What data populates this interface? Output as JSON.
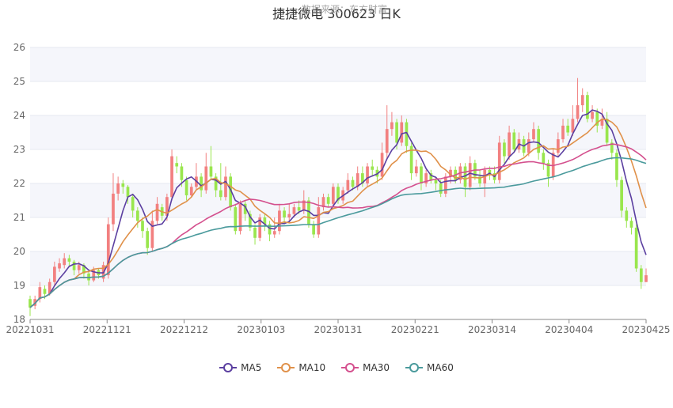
{
  "chart_data": {
    "type": "candlestick",
    "title": "捷捷微电 300623 日K",
    "watermark": "数据来源：东方财富",
    "ylim": [
      18,
      26
    ],
    "yticks": [
      18,
      19,
      20,
      21,
      22,
      23,
      24,
      25,
      26
    ],
    "xtick_labels": [
      "20221031",
      "20221121",
      "20221212",
      "20230103",
      "20230131",
      "20230221",
      "20230314",
      "20230404",
      "20230425"
    ],
    "colors": {
      "up": "#f28080",
      "down": "#99e64d",
      "grid": "#e6e8f0",
      "band": "#f5f6fb",
      "axis": "#888888"
    },
    "legend_position": "bottom-center",
    "candles": [
      [
        18.6,
        18.35,
        18.7,
        18.1
      ],
      [
        18.4,
        18.6,
        18.7,
        18.3
      ],
      [
        18.6,
        18.95,
        19.1,
        18.5
      ],
      [
        18.9,
        18.75,
        19.0,
        18.6
      ],
      [
        18.75,
        19.1,
        19.2,
        18.7
      ],
      [
        19.1,
        19.55,
        19.7,
        19.0
      ],
      [
        19.5,
        19.65,
        19.8,
        19.4
      ],
      [
        19.6,
        19.8,
        19.95,
        19.5
      ],
      [
        19.8,
        19.7,
        19.9,
        19.55
      ],
      [
        19.7,
        19.45,
        19.75,
        19.3
      ],
      [
        19.45,
        19.6,
        19.7,
        19.35
      ],
      [
        19.6,
        19.35,
        19.65,
        19.2
      ],
      [
        19.35,
        19.15,
        19.4,
        19.0
      ],
      [
        19.15,
        19.45,
        19.55,
        19.1
      ],
      [
        19.45,
        19.3,
        19.5,
        19.2
      ],
      [
        19.2,
        19.6,
        19.7,
        19.1
      ],
      [
        19.3,
        20.8,
        21.0,
        19.2
      ],
      [
        20.8,
        21.7,
        22.3,
        20.6
      ],
      [
        21.7,
        22.0,
        22.2,
        21.5
      ],
      [
        22.0,
        21.9,
        22.1,
        21.7
      ],
      [
        21.9,
        21.6,
        21.95,
        21.4
      ],
      [
        21.6,
        21.2,
        21.7,
        21.0
      ],
      [
        21.2,
        20.9,
        21.3,
        20.7
      ],
      [
        20.9,
        20.6,
        21.0,
        20.4
      ],
      [
        20.6,
        20.1,
        20.7,
        19.9
      ],
      [
        20.1,
        20.9,
        21.2,
        20.0
      ],
      [
        20.9,
        21.4,
        21.6,
        20.8
      ],
      [
        21.3,
        21.05,
        21.4,
        20.9
      ],
      [
        21.05,
        21.6,
        21.7,
        20.9
      ],
      [
        21.6,
        22.8,
        23.0,
        21.5
      ],
      [
        22.6,
        22.5,
        22.8,
        22.3
      ],
      [
        22.5,
        22.1,
        22.6,
        21.9
      ],
      [
        22.1,
        21.65,
        22.2,
        21.5
      ],
      [
        21.65,
        21.9,
        22.0,
        21.6
      ],
      [
        21.9,
        22.2,
        22.6,
        21.8
      ],
      [
        22.2,
        21.8,
        22.3,
        21.6
      ],
      [
        21.8,
        22.5,
        22.9,
        21.7
      ],
      [
        22.5,
        22.2,
        23.1,
        22.1
      ],
      [
        22.2,
        21.8,
        22.3,
        21.6
      ],
      [
        21.8,
        21.6,
        22.6,
        21.5
      ],
      [
        21.6,
        22.2,
        22.5,
        21.5
      ],
      [
        22.2,
        21.3,
        22.3,
        21.2
      ],
      [
        21.3,
        20.6,
        21.4,
        20.5
      ],
      [
        20.6,
        21.4,
        21.5,
        20.5
      ],
      [
        21.4,
        21.1,
        21.5,
        20.9
      ],
      [
        21.1,
        20.7,
        21.2,
        20.6
      ],
      [
        20.7,
        20.4,
        20.8,
        20.2
      ],
      [
        20.4,
        21.0,
        21.1,
        20.3
      ],
      [
        21.0,
        20.8,
        21.1,
        20.6
      ],
      [
        20.8,
        20.5,
        20.9,
        20.3
      ],
      [
        20.5,
        20.6,
        21.0,
        20.4
      ],
      [
        20.6,
        21.2,
        21.4,
        20.5
      ],
      [
        21.2,
        21.0,
        21.3,
        20.8
      ],
      [
        21.0,
        21.1,
        21.4,
        20.9
      ],
      [
        21.1,
        21.3,
        21.4,
        21.0
      ],
      [
        21.3,
        21.2,
        21.5,
        21.1
      ],
      [
        21.2,
        21.5,
        21.8,
        21.1
      ],
      [
        21.5,
        20.8,
        21.6,
        20.7
      ],
      [
        20.8,
        20.5,
        20.9,
        20.4
      ],
      [
        20.5,
        21.3,
        21.6,
        20.4
      ],
      [
        21.3,
        21.6,
        21.7,
        21.2
      ],
      [
        21.6,
        21.4,
        21.7,
        21.3
      ],
      [
        21.4,
        21.9,
        22.0,
        21.3
      ],
      [
        21.9,
        21.5,
        22.0,
        21.4
      ],
      [
        21.5,
        21.8,
        21.9,
        21.4
      ],
      [
        21.8,
        22.1,
        22.3,
        21.7
      ],
      [
        22.1,
        21.9,
        22.2,
        21.8
      ],
      [
        21.9,
        22.3,
        22.5,
        21.8
      ],
      [
        22.3,
        22.0,
        22.5,
        21.9
      ],
      [
        22.0,
        22.5,
        22.6,
        21.9
      ],
      [
        22.5,
        22.4,
        22.7,
        22.2
      ],
      [
        22.4,
        22.2,
        22.5,
        22.0
      ],
      [
        22.2,
        22.9,
        23.2,
        22.1
      ],
      [
        22.9,
        23.6,
        24.3,
        22.7
      ],
      [
        23.6,
        23.8,
        24.1,
        23.4
      ],
      [
        23.8,
        23.2,
        23.9,
        23.0
      ],
      [
        23.2,
        23.8,
        24.0,
        23.1
      ],
      [
        23.8,
        23.1,
        23.9,
        22.9
      ],
      [
        23.1,
        22.3,
        23.2,
        22.1
      ],
      [
        22.3,
        22.5,
        22.7,
        22.2
      ],
      [
        22.5,
        22.0,
        22.6,
        21.8
      ],
      [
        22.0,
        22.3,
        22.4,
        21.9
      ],
      [
        22.3,
        22.1,
        22.4,
        22.0
      ],
      [
        22.1,
        22.0,
        22.2,
        21.8
      ],
      [
        22.0,
        21.7,
        22.1,
        21.6
      ],
      [
        21.7,
        22.2,
        22.3,
        21.6
      ],
      [
        22.2,
        22.4,
        22.5,
        22.0
      ],
      [
        22.4,
        22.1,
        22.5,
        22.0
      ],
      [
        22.1,
        22.5,
        22.6,
        22.0
      ],
      [
        22.5,
        21.9,
        22.6,
        21.6
      ],
      [
        21.9,
        22.6,
        22.8,
        21.8
      ],
      [
        22.6,
        22.2,
        22.7,
        22.1
      ],
      [
        22.2,
        22.0,
        22.4,
        21.9
      ],
      [
        22.0,
        22.4,
        22.5,
        21.6
      ],
      [
        22.4,
        22.3,
        22.5,
        22.1
      ],
      [
        22.3,
        22.1,
        22.5,
        22.0
      ],
      [
        22.1,
        23.2,
        23.4,
        22.0
      ],
      [
        23.2,
        22.8,
        23.3,
        22.6
      ],
      [
        22.8,
        23.5,
        23.7,
        22.7
      ],
      [
        23.5,
        23.0,
        23.6,
        22.9
      ],
      [
        23.0,
        23.3,
        23.5,
        22.9
      ],
      [
        23.3,
        22.9,
        23.4,
        22.8
      ],
      [
        22.9,
        23.3,
        23.5,
        22.8
      ],
      [
        23.3,
        23.6,
        23.8,
        23.2
      ],
      [
        23.6,
        22.9,
        23.7,
        22.7
      ],
      [
        22.9,
        22.6,
        23.0,
        22.4
      ],
      [
        22.6,
        22.2,
        22.7,
        21.9
      ],
      [
        22.2,
        22.9,
        23.0,
        22.1
      ],
      [
        22.9,
        23.3,
        23.5,
        22.8
      ],
      [
        23.3,
        23.7,
        23.9,
        23.2
      ],
      [
        23.7,
        23.5,
        23.9,
        23.4
      ],
      [
        23.5,
        23.9,
        24.3,
        23.4
      ],
      [
        23.9,
        24.3,
        25.1,
        23.8
      ],
      [
        24.3,
        24.6,
        24.8,
        24.1
      ],
      [
        24.6,
        23.9,
        24.7,
        23.8
      ],
      [
        23.9,
        24.1,
        24.3,
        23.8
      ],
      [
        24.1,
        23.7,
        24.2,
        23.5
      ],
      [
        23.7,
        23.9,
        24.2,
        23.6
      ],
      [
        23.9,
        23.2,
        24.1,
        23.1
      ],
      [
        23.2,
        22.9,
        23.3,
        22.7
      ],
      [
        22.9,
        22.1,
        23.0,
        21.9
      ],
      [
        22.1,
        21.2,
        22.2,
        21.0
      ],
      [
        21.2,
        20.9,
        21.3,
        20.7
      ],
      [
        20.9,
        20.7,
        21.0,
        20.5
      ],
      [
        20.7,
        19.5,
        20.8,
        19.4
      ],
      [
        19.5,
        19.1,
        19.6,
        18.9
      ],
      [
        19.1,
        19.3,
        19.5,
        19.1
      ]
    ]
  },
  "legend": {
    "items": [
      {
        "label": "MA5",
        "color": "#5b3fa0"
      },
      {
        "label": "MA10",
        "color": "#e0914a"
      },
      {
        "label": "MA30",
        "color": "#d4508e"
      },
      {
        "label": "MA60",
        "color": "#4a9a9c"
      }
    ]
  }
}
